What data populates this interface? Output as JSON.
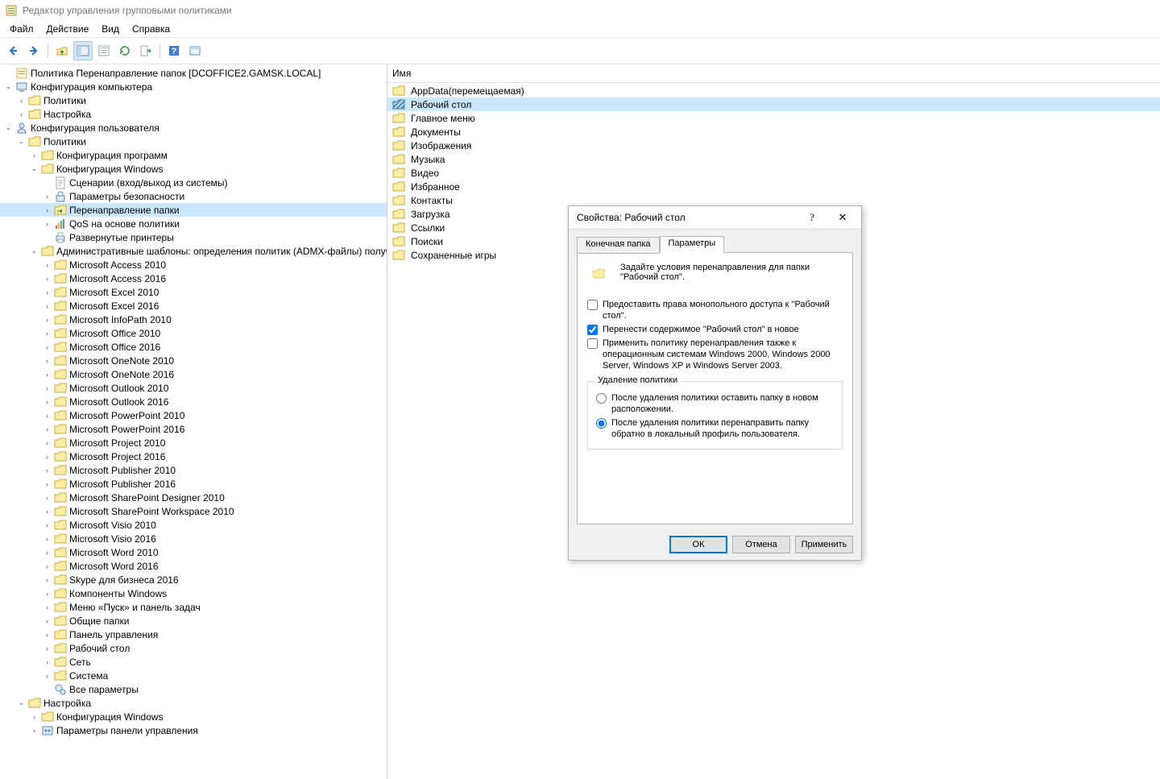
{
  "app": {
    "title": "Редактор управления групповыми политиками"
  },
  "menu": {
    "file": "Файл",
    "action": "Действие",
    "view": "Вид",
    "help": "Справка"
  },
  "treeRoot": "Политика Перенаправление папок [DCOFFICE2.GAMSK.LOCAL]",
  "tree": {
    "cc": "Конфигурация компьютера",
    "cc_pol": "Политики",
    "cc_pref": "Настройка",
    "uc": "Конфигурация пользователя",
    "uc_pol": "Политики",
    "sw": "Конфигурация программ",
    "win": "Конфигурация Windows",
    "scripts": "Сценарии (вход/выход из системы)",
    "sec": "Параметры безопасности",
    "redir": "Перенаправление папки",
    "qos": "QoS на основе политики",
    "printers": "Развернутые принтеры",
    "adm": "Административные шаблоны: определения политик (ADMX-файлы) получены",
    "adm_items": [
      "Microsoft Access 2010",
      "Microsoft Access 2016",
      "Microsoft Excel 2010",
      "Microsoft Excel 2016",
      "Microsoft InfoPath 2010",
      "Microsoft Office 2010",
      "Microsoft Office 2016",
      "Microsoft OneNote 2010",
      "Microsoft OneNote 2016",
      "Microsoft Outlook 2010",
      "Microsoft Outlook 2016",
      "Microsoft PowerPoint 2010",
      "Microsoft PowerPoint 2016",
      "Microsoft Project 2010",
      "Microsoft Project 2016",
      "Microsoft Publisher 2010",
      "Microsoft Publisher 2016",
      "Microsoft SharePoint Designer 2010",
      "Microsoft SharePoint Workspace 2010",
      "Microsoft Visio 2010",
      "Microsoft Visio 2016",
      "Microsoft Word 2010",
      "Microsoft Word 2016",
      "Skype для бизнеса 2016",
      "Компоненты Windows",
      "Меню «Пуск» и панель задач",
      "Общие папки",
      "Панель управления",
      "Рабочий стол",
      "Сеть",
      "Система"
    ],
    "allsettings": "Все параметры",
    "uc_pref": "Настройка",
    "pref_win": "Конфигурация Windows",
    "pref_cp": "Параметры панели управления"
  },
  "list": {
    "header": "Имя",
    "items": [
      "AppData(перемещаемая)",
      "Рабочий стол",
      "Главное меню",
      "Документы",
      "Изображения",
      "Музыка",
      "Видео",
      "Избранное",
      "Контакты",
      "Загрузка",
      "Ссылки",
      "Поиски",
      "Сохраненные игры"
    ],
    "selected": 1
  },
  "dialog": {
    "title": "Свойства: Рабочий стол",
    "tabs": {
      "target": "Конечная папка",
      "settings": "Параметры"
    },
    "desc": "Задайте условия перенаправления для папки \"Рабочий стол\".",
    "chk1": "Предоставить права монопольного доступа к \"Рабочий стол\".",
    "chk2": "Перенести содержимое \"Рабочий стол\" в новое",
    "chk3": "Применить политику перенаправления также к операционным системам Windows 2000, Windows 2000 Server, Windows XP и Windows Server 2003.",
    "group": "Удаление политики",
    "rad1": "После удаления политики оставить папку в новом расположении.",
    "rad2": "После удаления политики перенаправить папку обратно в локальный профиль пользователя.",
    "ok": "ОК",
    "cancel": "Отмена",
    "apply": "Применить",
    "help": "?",
    "close": "✕"
  }
}
